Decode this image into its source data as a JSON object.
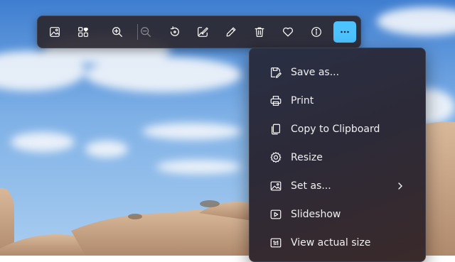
{
  "colors": {
    "toolbar_bg": "#2c2830",
    "active_button": "#4cc2ff",
    "menu_text": "#f0f0f0",
    "icon_stroke": "#ffffff"
  },
  "toolbar": {
    "buttons": [
      {
        "name": "view-all-photos",
        "icon": "image-icon"
      },
      {
        "name": "add-to-album",
        "icon": "album-grid-icon"
      },
      {
        "name": "zoom-in",
        "icon": "zoom-in-icon"
      },
      {
        "name": "zoom-out",
        "icon": "zoom-out-icon",
        "disabled": true
      },
      {
        "name": "rotate",
        "icon": "rotate-icon"
      },
      {
        "name": "edit-image",
        "icon": "edit-image-icon"
      },
      {
        "name": "draw",
        "icon": "pencil-icon"
      },
      {
        "name": "delete",
        "icon": "trash-icon"
      },
      {
        "name": "favorite",
        "icon": "heart-icon"
      },
      {
        "name": "file-info",
        "icon": "info-icon"
      },
      {
        "name": "see-more",
        "icon": "more-icon",
        "active": true
      }
    ]
  },
  "menu": {
    "items": [
      {
        "label": "Save as...",
        "icon": "save-as-icon"
      },
      {
        "label": "Print",
        "icon": "print-icon"
      },
      {
        "label": "Copy to Clipboard",
        "icon": "copy-icon"
      },
      {
        "label": "Resize",
        "icon": "gear-icon"
      },
      {
        "label": "Set as...",
        "icon": "set-as-icon",
        "submenu": true
      },
      {
        "label": "Slideshow",
        "icon": "slideshow-icon"
      },
      {
        "label": "View actual size",
        "icon": "actual-size-icon"
      }
    ]
  }
}
